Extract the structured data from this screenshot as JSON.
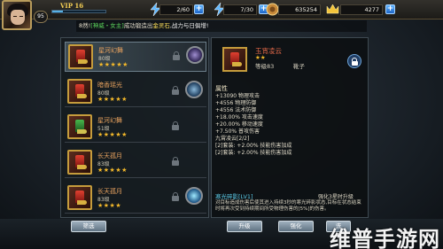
{
  "player": {
    "vip": "VIP 16",
    "level": "95"
  },
  "resources": {
    "stamina": "2/60",
    "energy": "7/30",
    "coins": "635254",
    "gems": "4277"
  },
  "announcement": {
    "prefix": "8然!",
    "player": "[神威・女主]",
    "text": "成功锻造出",
    "item": "金灵石",
    "suffix": ",战力与日俱增!"
  },
  "equipment_list": [
    {
      "name": "星河幻舞",
      "level": "80级",
      "stars": "★★★★★",
      "gem": "purple",
      "selected": true,
      "color": "red"
    },
    {
      "name": "暗香瑶光",
      "level": "80级",
      "stars": "★★★★★",
      "gem": "blue",
      "selected": false,
      "color": "red"
    },
    {
      "name": "星河幻舞",
      "level": "51级",
      "stars": "★★★★★",
      "gem": "none",
      "selected": false,
      "color": "green"
    },
    {
      "name": "长天孤月",
      "level": "83级",
      "stars": "★★★★★",
      "gem": "none",
      "selected": false,
      "color": "red"
    },
    {
      "name": "长天孤月",
      "level": "83级",
      "stars": "★★★★",
      "gem": "cyan",
      "selected": false,
      "color": "red"
    }
  ],
  "detail": {
    "name": "玉宵凌云",
    "stars": "★★",
    "level": "等级83",
    "type": "靴子",
    "attr_header": "属性",
    "attributes": [
      "+13090 物理攻击",
      "+4556 物理防御",
      "+4556 法术防御",
      "+18.00% 攻击速度",
      "+20.00% 移动速度",
      "+7.50% 普攻伤害"
    ],
    "set_title": "九霄凌云[2/2]",
    "set_lines": [
      "[2]套装: +2.00% 技能伤害加成",
      "[2]套装: +2.00% 技能伤害加成"
    ],
    "skill_title": "寒光碎影[LV1]",
    "strengthen": "强化3星时升级",
    "skill_text": "对目标造成伤害后使其进入持续3秒的寒光碎影状态,目标在状态结束时将再次受到持续期间所受物理伤害的[5%]的伤害。"
  },
  "buttons": {
    "filter": "筛选",
    "upgrade": "升级",
    "strengthen": "强化",
    "wash": "洗"
  },
  "watermark": "维普手游网",
  "colors": {
    "gold": "#c59c3c",
    "item_name": "#e9a35f",
    "set_red": "#ff5b4a",
    "skill_cyan": "#5ccbe8"
  }
}
